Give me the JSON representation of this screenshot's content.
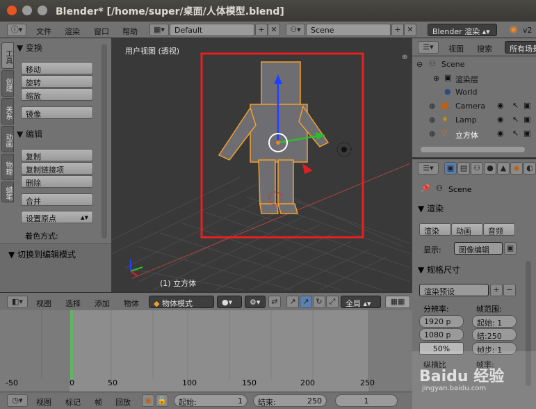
{
  "window": {
    "title": "Blender* [/home/super/桌面/人体模型.blend]",
    "controls": {
      "close_color": "#e95420",
      "min_color": "#9b9b9b",
      "max_color": "#9b9b9b"
    }
  },
  "info_header": {
    "menus": [
      "文件",
      "渲染",
      "窗口",
      "帮助"
    ],
    "screen_layout": "Default",
    "scene": "Scene",
    "engine": "Blender 渲染",
    "version": "v2"
  },
  "tool_shelf": {
    "tabs": [
      "工具",
      "创建",
      "关系",
      "动画",
      "物理",
      "蜡笔"
    ],
    "transform_panel": {
      "title": "▼ 变换",
      "buttons": [
        "移动",
        "旋转",
        "缩放",
        "镜像"
      ]
    },
    "edit_panel": {
      "title": "▼ 编辑",
      "buttons": [
        "复制",
        "复制链接项",
        "删除",
        "合并"
      ],
      "set_origin": "设置原点",
      "shading_label": "着色方式:"
    },
    "operator_panel": "▼ 切换到编辑模式"
  },
  "viewport": {
    "label": "用户视图 (透视)",
    "object_label": "(1) 立方体",
    "highlight_color": "#e8201f"
  },
  "view_header": {
    "menus": [
      "视图",
      "选择",
      "添加",
      "物体"
    ],
    "mode": "物体模式",
    "pivot": "全局"
  },
  "outliner": {
    "header_menus": [
      "视图",
      "搜索"
    ],
    "filter": "所有场景",
    "items": [
      {
        "name": "Scene",
        "icon": "scene-icon"
      },
      {
        "name": "渲染层",
        "icon": "render-layer-icon"
      },
      {
        "name": "World",
        "icon": "world-icon"
      },
      {
        "name": "Camera",
        "icon": "camera-icon"
      },
      {
        "name": "Lamp",
        "icon": "lamp-icon"
      },
      {
        "name": "立方体",
        "icon": "mesh-icon"
      }
    ]
  },
  "properties": {
    "context": "Scene",
    "render_panel": "▼ 渲染",
    "render_buttons": [
      "渲染",
      "动画",
      "音频"
    ],
    "display_label": "显示:",
    "display_value": "图像编辑",
    "dimensions_panel": "▼ 规格尺寸",
    "render_preset": "渲染预设",
    "resolution_label": "分辨率:",
    "res_x": "1920 p",
    "res_y": "1080 p",
    "res_pct": "50%",
    "frame_range_label": "帧范围:",
    "start": "起始: 1",
    "end": "结:250",
    "step": "帧步: 1",
    "aspect_label": "纵横比",
    "fps_label": "帧率:"
  },
  "timeline": {
    "ticks": [
      "-50",
      "0",
      "50",
      "100",
      "150",
      "200",
      "250"
    ],
    "current_frame_color": "#3fd23f",
    "menus": [
      "视图",
      "标记",
      "帧",
      "回放"
    ],
    "start_label": "起始:",
    "start_value": "1",
    "end_label": "结束:",
    "end_value": "250",
    "current": "1"
  },
  "watermark": {
    "text": "Baidu 经验",
    "sub": "jingyan.baidu.com"
  }
}
